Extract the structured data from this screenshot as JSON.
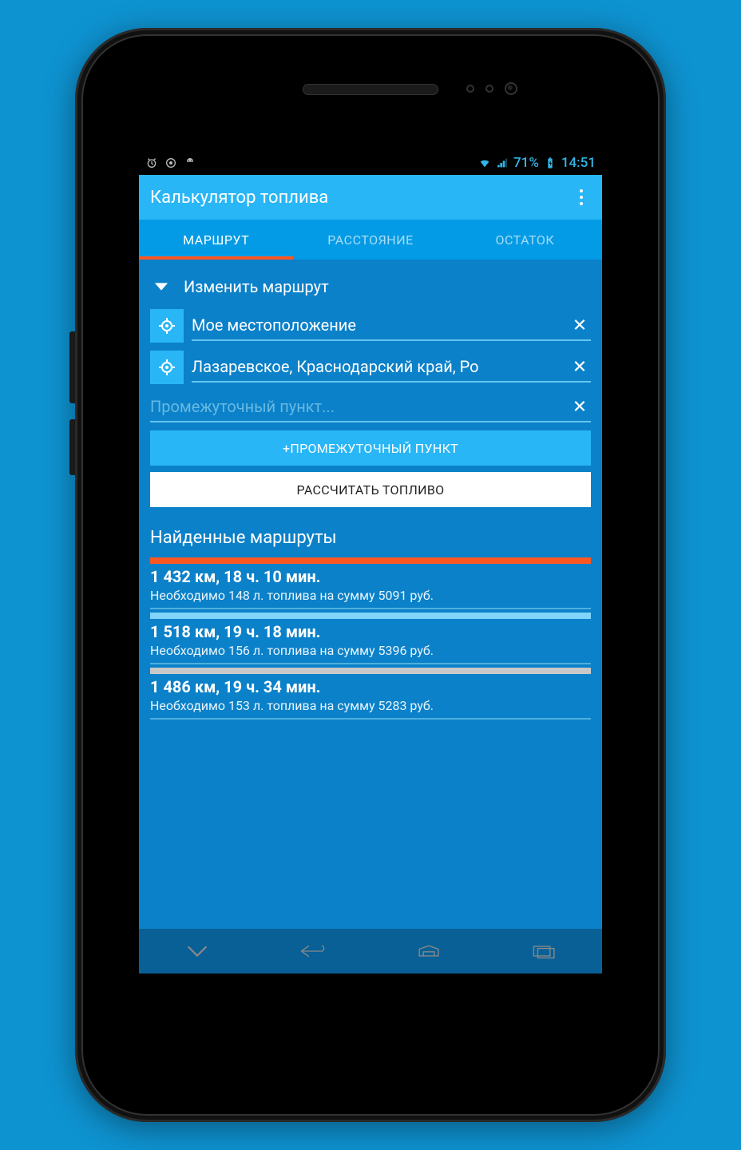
{
  "status": {
    "battery": "71%",
    "time": "14:51"
  },
  "app": {
    "title": "Калькулятор топлива"
  },
  "tabs": [
    {
      "label": "МАРШРУТ",
      "active": true
    },
    {
      "label": "РАССТОЯНИЕ",
      "active": false
    },
    {
      "label": "ОСТАТОК",
      "active": false
    }
  ],
  "collapse_label": "Изменить маршрут",
  "fields": {
    "origin": "Мое местоположение",
    "destination": "Лазаревское, Краснодарский край, Ро",
    "waypoint_placeholder": "Промежуточный пункт..."
  },
  "buttons": {
    "add_waypoint": "+ПРОМЕЖУТОЧНЫЙ ПУНКТ",
    "calculate": "РАССЧИТАТЬ ТОПЛИВО"
  },
  "results_heading": "Найденные маршруты",
  "routes": [
    {
      "color": "orange",
      "label": "1 432 км, 18 ч. 10 мин.",
      "detail": "Необходимо 148 л. топлива на сумму 5091 руб."
    },
    {
      "color": "light",
      "label": "1 518 км, 19 ч. 18 мин.",
      "detail": "Необходимо 156 л. топлива на сумму 5396 руб."
    },
    {
      "color": "gray",
      "label": "1 486 км, 19 ч. 34 мин.",
      "detail": "Необходимо 153 л. топлива на сумму 5283 руб."
    }
  ]
}
